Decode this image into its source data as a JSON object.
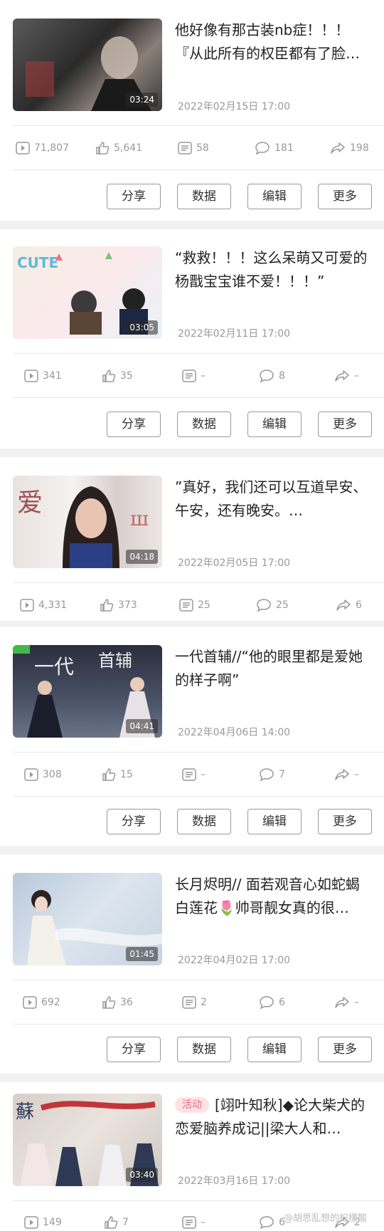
{
  "posts": [
    {
      "title": "他好像有那古装nb症！！！『从此所有的权臣都有了脸…",
      "badge": "",
      "duration": "03:24",
      "date": "2022年02月15日 17:00",
      "views": "71,807",
      "likes": "5,641",
      "danmaku": "58",
      "comments": "181",
      "shares": "198"
    },
    {
      "title": "“救救！！！这么呆萌又可爱的杨戬宝宝谁不爱！！！”",
      "badge": "",
      "duration": "03:05",
      "date": "2022年02月11日 17:00",
      "views": "341",
      "likes": "35",
      "danmaku": "–",
      "comments": "8",
      "shares": "–"
    },
    {
      "title": "”真好，我们还可以互道早安、午安，还有晚安。…",
      "badge": "",
      "duration": "04:18",
      "date": "2022年02月05日 17:00",
      "views": "4,331",
      "likes": "373",
      "danmaku": "25",
      "comments": "25",
      "shares": "6"
    },
    {
      "title": "一代首辅//“他的眼里都是爱她的样子啊”",
      "badge": "",
      "duration": "04:41",
      "date": "2022年04月06日 14:00",
      "views": "308",
      "likes": "15",
      "danmaku": "–",
      "comments": "7",
      "shares": "–"
    },
    {
      "title": "长月烬明// 面若观音心如蛇蝎白莲花🌷帅哥靓女真的很…",
      "badge": "",
      "duration": "01:45",
      "date": "2022年04月02日 17:00",
      "views": "692",
      "likes": "36",
      "danmaku": "2",
      "comments": "6",
      "shares": "–"
    },
    {
      "title": "[翊叶知秋]◆论大柴犬的恋爱脑养成记||梁大人和…",
      "badge": "活动",
      "duration": "03:40",
      "date": "2022年03月16日 17:00",
      "views": "149",
      "likes": "7",
      "danmaku": "–",
      "comments": "6",
      "shares": "2"
    }
  ],
  "actions": {
    "share": "分享",
    "data": "数据",
    "edit": "编辑",
    "more": "更多"
  },
  "icons": [
    "play-icon",
    "like-icon",
    "danmaku-icon",
    "comment-icon",
    "share-icon"
  ],
  "watermark": "@胡思乱想的柠檬酸"
}
